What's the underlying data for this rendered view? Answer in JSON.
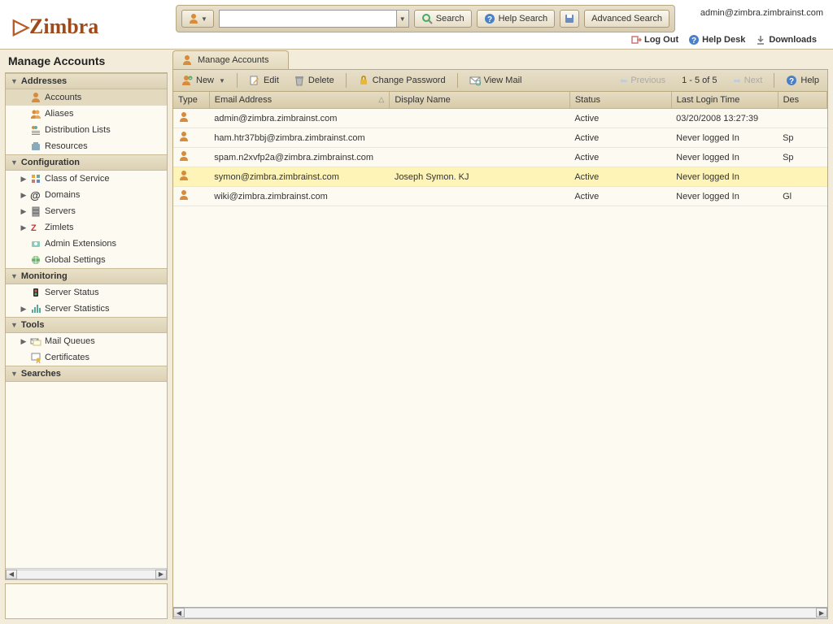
{
  "logo": "Zimbra",
  "search": {
    "search_label": "Search",
    "help_search_label": "Help Search",
    "advanced_search_label": "Advanced Search"
  },
  "user_email": "admin@zimbra.zimbrainst.com",
  "header_links": {
    "logout": "Log Out",
    "helpdesk": "Help Desk",
    "downloads": "Downloads"
  },
  "page_title": "Manage Accounts",
  "tab_label": "Manage Accounts",
  "sidebar": {
    "sections": [
      {
        "label": "Addresses",
        "items": [
          {
            "label": "Accounts",
            "icon": "person",
            "selected": true
          },
          {
            "label": "Aliases",
            "icon": "people"
          },
          {
            "label": "Distribution Lists",
            "icon": "list"
          },
          {
            "label": "Resources",
            "icon": "resource"
          }
        ]
      },
      {
        "label": "Configuration",
        "items": [
          {
            "label": "Class of Service",
            "icon": "cos",
            "expandable": true
          },
          {
            "label": "Domains",
            "icon": "at",
            "expandable": true
          },
          {
            "label": "Servers",
            "icon": "server",
            "expandable": true
          },
          {
            "label": "Zimlets",
            "icon": "zimlet",
            "expandable": true
          },
          {
            "label": "Admin Extensions",
            "icon": "ext"
          },
          {
            "label": "Global Settings",
            "icon": "globe"
          }
        ]
      },
      {
        "label": "Monitoring",
        "items": [
          {
            "label": "Server Status",
            "icon": "status"
          },
          {
            "label": "Server Statistics",
            "icon": "stats",
            "expandable": true
          }
        ]
      },
      {
        "label": "Tools",
        "items": [
          {
            "label": "Mail Queues",
            "icon": "queue",
            "expandable": true
          },
          {
            "label": "Certificates",
            "icon": "cert"
          }
        ]
      },
      {
        "label": "Searches",
        "items": []
      }
    ]
  },
  "toolbar": {
    "new": "New",
    "edit": "Edit",
    "delete": "Delete",
    "change_password": "Change Password",
    "view_mail": "View Mail",
    "previous": "Previous",
    "range": "1 - 5 of 5",
    "next": "Next",
    "help": "Help"
  },
  "columns": {
    "type": "Type",
    "email": "Email Address",
    "display": "Display Name",
    "status": "Status",
    "login": "Last Login Time",
    "desc": "Des"
  },
  "rows": [
    {
      "email": "admin@zimbra.zimbrainst.com",
      "display": "",
      "status": "Active",
      "login": "03/20/2008 13:27:39",
      "desc": ""
    },
    {
      "email": "ham.htr37bbj@zimbra.zimbrainst.com",
      "display": "",
      "status": "Active",
      "login": "Never logged In",
      "desc": "Sp"
    },
    {
      "email": "spam.n2xvfp2a@zimbra.zimbrainst.com",
      "display": "",
      "status": "Active",
      "login": "Never logged In",
      "desc": "Sp"
    },
    {
      "email": "symon@zimbra.zimbrainst.com",
      "display": "Joseph Symon. KJ",
      "status": "Active",
      "login": "Never logged In",
      "desc": "",
      "selected": true
    },
    {
      "email": "wiki@zimbra.zimbrainst.com",
      "display": "",
      "status": "Active",
      "login": "Never logged In",
      "desc": "Gl"
    }
  ]
}
